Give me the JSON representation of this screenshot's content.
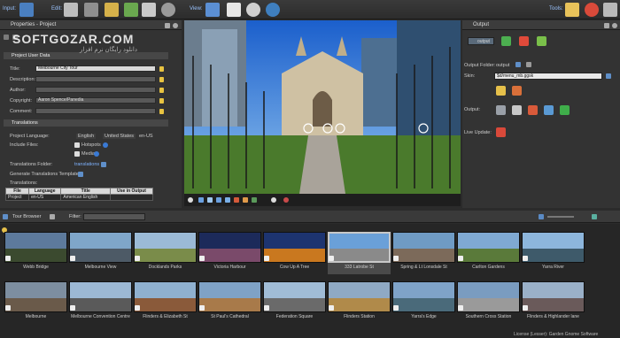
{
  "toolbar": {
    "input_label": "Input:",
    "edit_label": "Edit:",
    "view_label": "View:",
    "tools_label": "Tools:",
    "icons": [
      "import-icon",
      "grid-icon",
      "patch-icon",
      "pin-icon",
      "map-icon",
      "film-icon",
      "binoculars-icon",
      "document-icon",
      "clock-icon",
      "eye-icon",
      "lamp-icon",
      "cloud-icon",
      "gear-icon"
    ]
  },
  "watermark": {
    "text": "SOFTGOZAR.COM",
    "sub": "دانلود رایگان نرم افزار"
  },
  "properties": {
    "title": "Properties - Project",
    "section_user": "Project User Data",
    "fields": [
      {
        "label": "Title:",
        "value": "Melbourne City Tour"
      },
      {
        "label": "Description:",
        "value": ""
      },
      {
        "label": "Author:",
        "value": ""
      },
      {
        "label": "Copyright:",
        "value": "Aaron Spence/Panedia"
      },
      {
        "label": "Comment:",
        "value": ""
      }
    ],
    "section_translations": "Translations",
    "project_language_label": "Project Language:",
    "language": "English",
    "country": "United States",
    "locale": "en-US",
    "include_files_label": "Include Files:",
    "hotspots_label": "Hotspots",
    "media_label": "Media",
    "translations_folder_label": "Translations Folder:",
    "translations_folder_value": "translations",
    "generate_label": "Generate Translations Template:",
    "translations_label": "Translations:",
    "table_headers": [
      "File",
      "Language",
      "Title",
      "Use in Output"
    ],
    "table_rows": [
      [
        "Project",
        "en-US",
        "American English",
        ""
      ]
    ]
  },
  "output": {
    "title": "Output",
    "select_value": "output",
    "folder_label": "Output Folder:",
    "folder_value": "output",
    "skin_label": "Skin:",
    "skin_value": "$d/menu_mb.ggsk",
    "output_label": "Output:",
    "live_update_label": "Live Update:"
  },
  "browser": {
    "title": "Tour Browser",
    "filter_label": "Filter:",
    "thumbs": [
      {
        "name": "Webb Bridge",
        "c1": "#5d7a9c",
        "c2": "#3b4a2f"
      },
      {
        "name": "Melbourne View",
        "c1": "#7fa6c9",
        "c2": "#4d5a66"
      },
      {
        "name": "Docklands Parks",
        "c1": "#9bbad6",
        "c2": "#7a8c4a"
      },
      {
        "name": "Victoria Harbour",
        "c1": "#1c2a5a",
        "c2": "#7a4a6a"
      },
      {
        "name": "Cow Up A Tree",
        "c1": "#1d3470",
        "c2": "#c9781f"
      },
      {
        "name": "333 Latrobe St",
        "c1": "#6aa0d8",
        "c2": "#8a8a8a",
        "selected": true
      },
      {
        "name": "Spring & Lt Lonsdale St",
        "c1": "#6f9bc4",
        "c2": "#7c6a5a"
      },
      {
        "name": "Carlton Gardens",
        "c1": "#7fa9d2",
        "c2": "#5a7a3a"
      },
      {
        "name": "Yarra River",
        "c1": "#8db6dc",
        "c2": "#3e5a6a"
      },
      {
        "name": "Melbourne",
        "c1": "#7d8ea0",
        "c2": "#6a5a4a"
      },
      {
        "name": "Melbourne Convention Centre",
        "c1": "#9cb8d4",
        "c2": "#5a5a5a"
      },
      {
        "name": "Flinders & Elizabeth St",
        "c1": "#8fb0cf",
        "c2": "#8a5a3a"
      },
      {
        "name": "St Paul's Cathedral",
        "c1": "#7fa2c6",
        "c2": "#a87a4a"
      },
      {
        "name": "Federation Square",
        "c1": "#a0bcd6",
        "c2": "#6a6a6a"
      },
      {
        "name": "Flinders Station",
        "c1": "#8fa9c4",
        "c2": "#b08a4a"
      },
      {
        "name": "Yarra's Edge",
        "c1": "#7fa3c8",
        "c2": "#4a6a7a"
      },
      {
        "name": "Southern Cross Station",
        "c1": "#7a9cc0",
        "c2": "#9a9a9a"
      },
      {
        "name": "Flinders & Highlander lane",
        "c1": "#9ab0c8",
        "c2": "#6a5a5a"
      }
    ]
  },
  "footer": {
    "license": "License (Lesser): Garden Gnome Software"
  }
}
